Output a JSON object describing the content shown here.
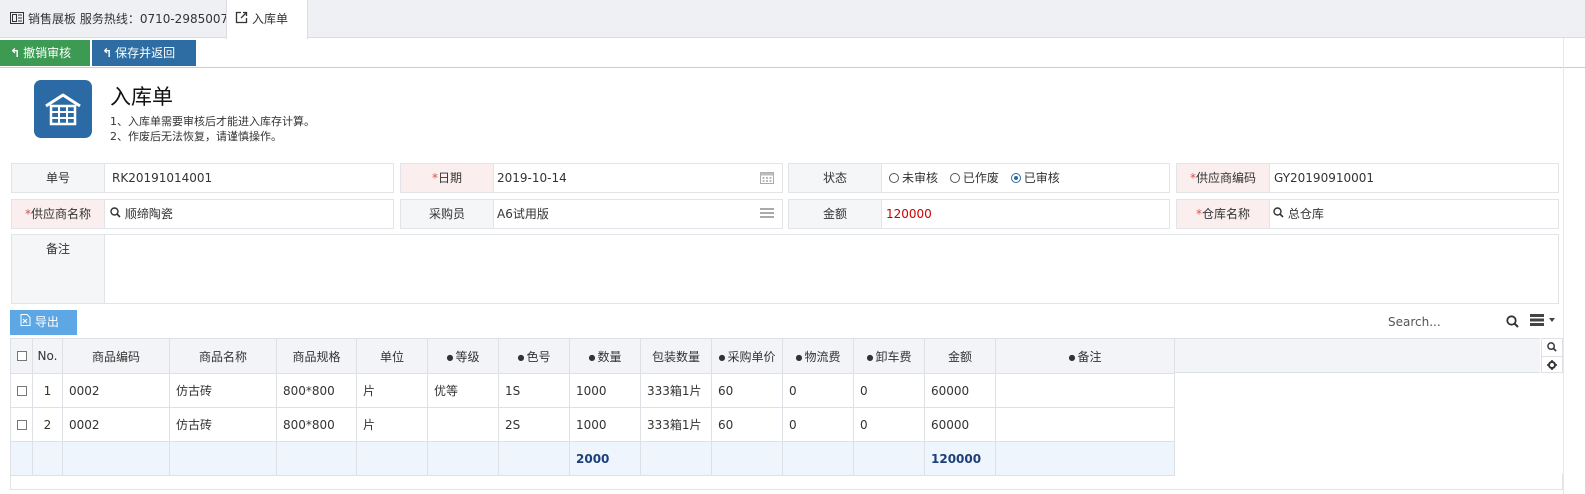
{
  "tabs": [
    {
      "label": "销售展板 服务热线：0710-2985007",
      "icon": "board-icon"
    },
    {
      "label": "入库单",
      "icon": "external-link-icon"
    }
  ],
  "toolbar": {
    "unaudit_label": "撤销审核",
    "save_return_label": "保存并返回"
  },
  "header": {
    "title": "入库单",
    "notes": [
      "1、入库单需要审核后才能进入库存计算。",
      "2、作废后无法恢复，请谨慎操作。"
    ],
    "icon": "warehouse-icon",
    "icon_color": "#2b6aa5"
  },
  "form": {
    "order_no": {
      "label": "单号",
      "value": "RK20191014001"
    },
    "date": {
      "label": "日期",
      "value": "2019-10-14"
    },
    "status": {
      "label": "状态",
      "options": [
        "未审核",
        "已作废",
        "已审核"
      ],
      "selected": "已审核"
    },
    "supplier_code": {
      "label": "供应商编码",
      "value": "GY20190910001"
    },
    "supplier_name": {
      "label": "供应商名称",
      "value": "顺缔陶瓷"
    },
    "purchaser": {
      "label": "采购员",
      "value": "A6试用版"
    },
    "amount": {
      "label": "金额",
      "value": "120000"
    },
    "warehouse": {
      "label": "仓库名称",
      "value": "总仓库"
    },
    "remark": {
      "label": "备注",
      "value": ""
    }
  },
  "grid_toolbar": {
    "export_label": "导出",
    "search_placeholder": "Search..."
  },
  "table": {
    "columns": [
      "No.",
      "商品编码",
      "商品名称",
      "商品规格",
      "单位",
      "等级",
      "色号",
      "数量",
      "包装数量",
      "采购单价",
      "物流费",
      "卸车费",
      "金额",
      "备注"
    ],
    "rows": [
      [
        "1",
        "0002",
        "仿古砖",
        "800*800",
        "片",
        "优等",
        "1S",
        "1000",
        "333箱1片",
        "60",
        "0",
        "0",
        "60000",
        ""
      ],
      [
        "2",
        "0002",
        "仿古砖",
        "800*800",
        "片",
        "",
        "2S",
        "1000",
        "333箱1片",
        "60",
        "0",
        "0",
        "60000",
        ""
      ]
    ],
    "summary": {
      "qty": "2000",
      "amount": "120000"
    }
  }
}
